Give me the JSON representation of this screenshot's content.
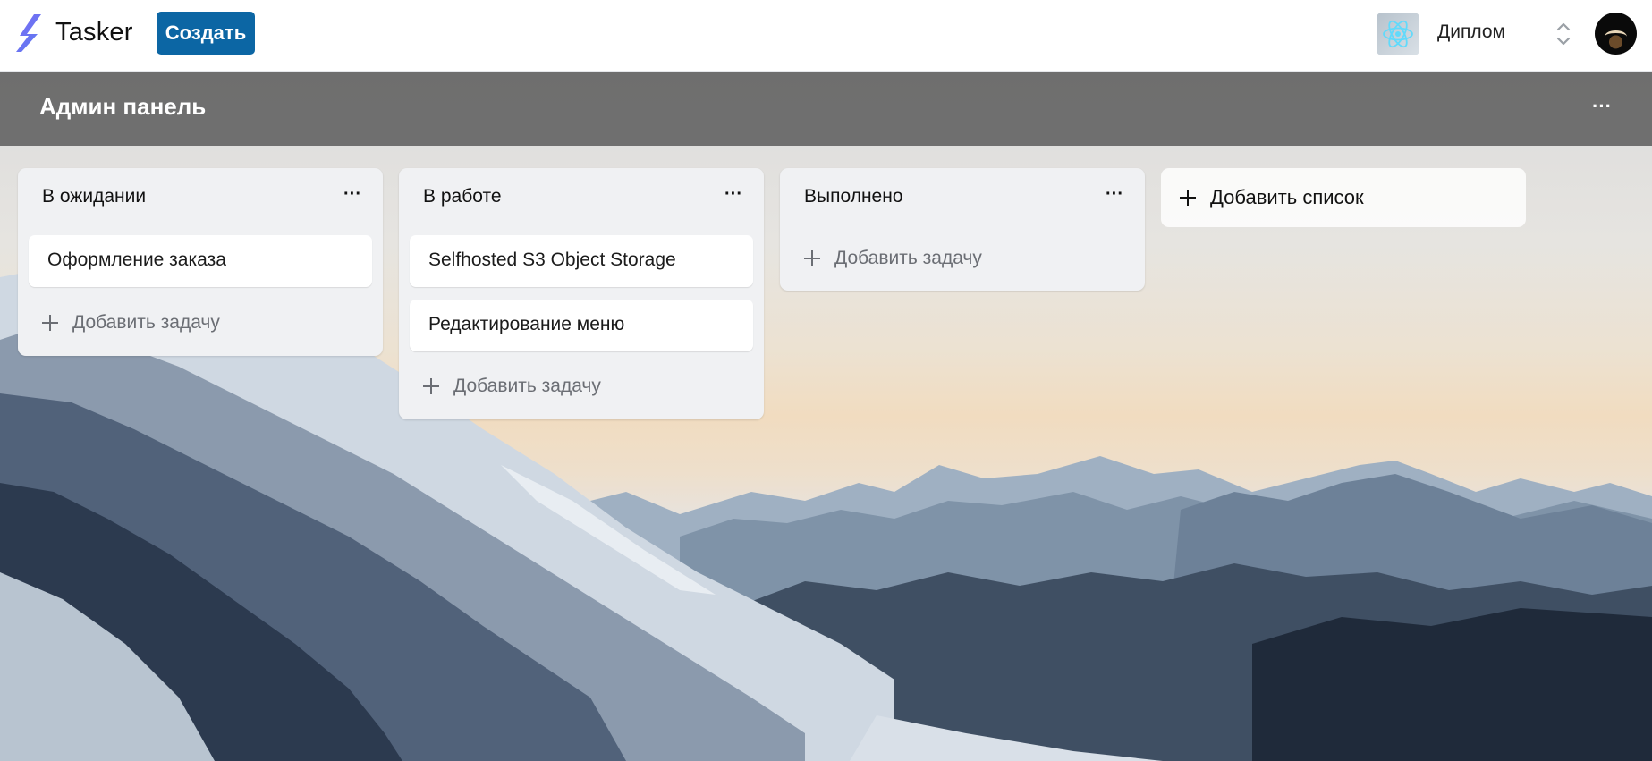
{
  "app": {
    "brand": "Tasker",
    "create_label": "Создать",
    "workspace_name": "Диплом",
    "logo_icon": "tasker-logo-icon",
    "accent_color": "#0c66a4"
  },
  "board": {
    "title": "Админ панель",
    "menu_label": "···",
    "lists": [
      {
        "title": "В ожидании",
        "menu_label": "···",
        "cards": [
          "Оформление заказа"
        ],
        "add_task_label": "Добавить задачу"
      },
      {
        "title": "В работе",
        "menu_label": "···",
        "cards": [
          "Selfhosted S3 Object Storage",
          "Редактирование меню"
        ],
        "add_task_label": "Добавить задачу"
      },
      {
        "title": "Выполнено",
        "menu_label": "···",
        "cards": [],
        "add_task_label": "Добавить задачу"
      }
    ],
    "add_list_label": "Добавить список"
  }
}
